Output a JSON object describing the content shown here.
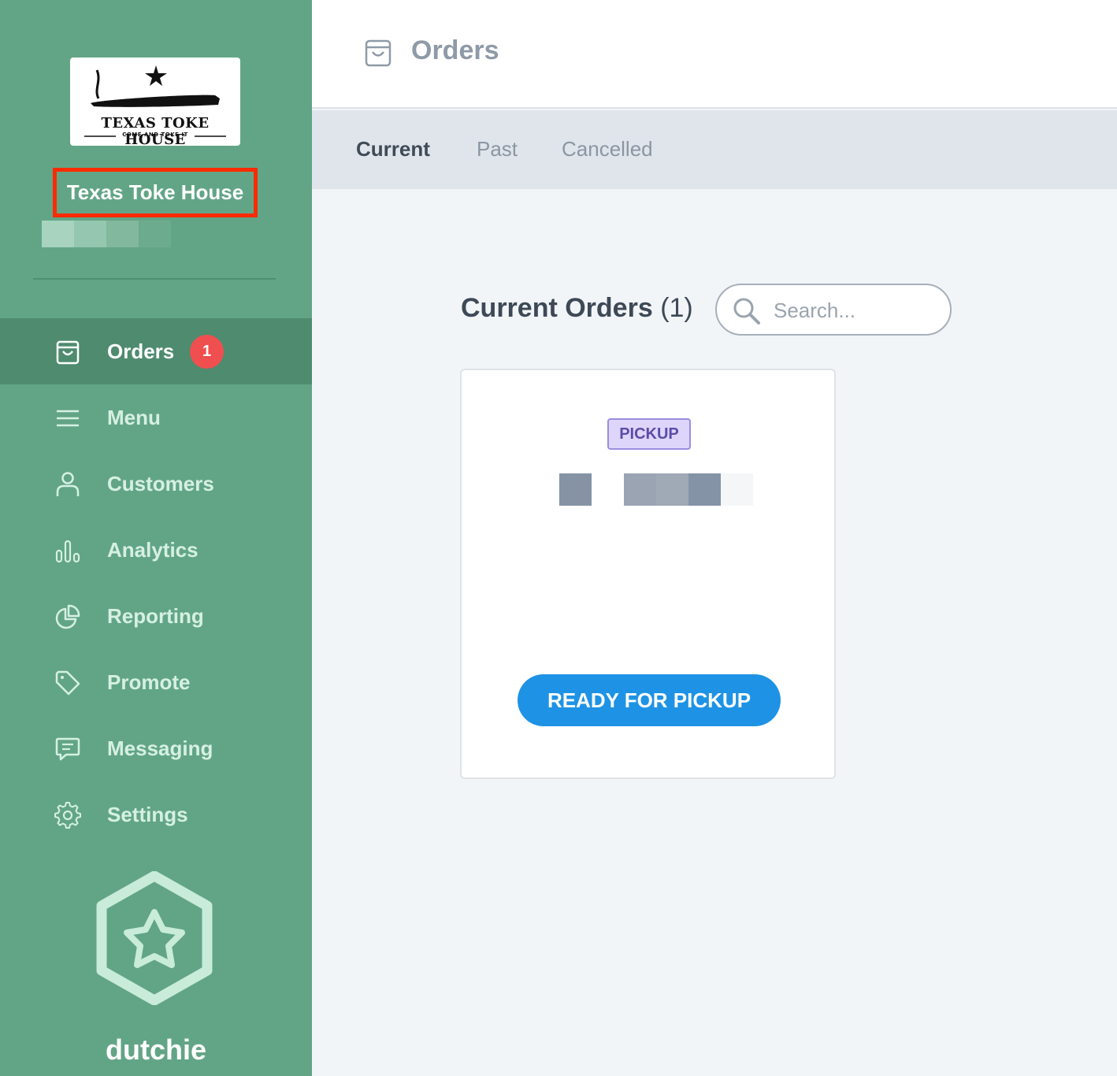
{
  "sidebar": {
    "logo": {
      "title": "TEXAS TOKE HOUSE",
      "subtitle": "COME AND TOKE IT"
    },
    "store_name": "Texas Toke House",
    "nav": [
      {
        "label": "Orders",
        "icon": "shopping-bag-icon",
        "active": true,
        "badge": "1"
      },
      {
        "label": "Menu",
        "icon": "menu-icon"
      },
      {
        "label": "Customers",
        "icon": "user-icon"
      },
      {
        "label": "Analytics",
        "icon": "bar-chart-icon"
      },
      {
        "label": "Reporting",
        "icon": "pie-chart-icon"
      },
      {
        "label": "Promote",
        "icon": "tag-icon"
      },
      {
        "label": "Messaging",
        "icon": "message-icon"
      },
      {
        "label": "Settings",
        "icon": "gear-icon"
      }
    ],
    "brand": "dutchie"
  },
  "header": {
    "title": "Orders",
    "icon": "shopping-bag-icon"
  },
  "tabs": [
    {
      "label": "Current",
      "active": true
    },
    {
      "label": "Past"
    },
    {
      "label": "Cancelled"
    }
  ],
  "main": {
    "section_title": "Current Orders",
    "section_count": "(1)",
    "search_placeholder": "Search..."
  },
  "order_card": {
    "type_tag": "PICKUP",
    "action_label": "READY FOR PICKUP"
  },
  "colors": {
    "sidebar_bg": "#62a586",
    "sidebar_active": "#4e8b6f",
    "badge": "#f04f4f",
    "action_button": "#1e93e5",
    "pickup_tag_bg": "#ddd6fa",
    "highlight_box": "#ff2a00"
  }
}
